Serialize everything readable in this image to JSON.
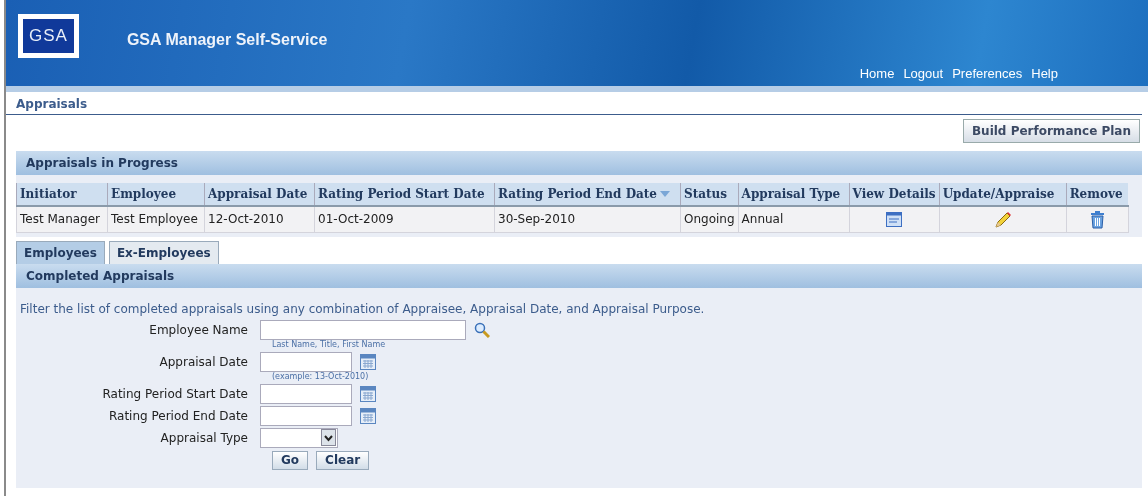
{
  "header": {
    "logo": "GSA",
    "title": "GSA Manager Self-Service",
    "links": [
      "Home",
      "Logout",
      "Preferences",
      "Help"
    ]
  },
  "page_title": "Appraisals",
  "actions": [
    "Build Performance Plan"
  ],
  "in_progress": {
    "title": "Appraisals in Progress",
    "columns": [
      {
        "label": "Initiator",
        "sorted": false
      },
      {
        "label": "Employee",
        "sorted": false
      },
      {
        "label": "Appraisal Date",
        "sorted": false
      },
      {
        "label": "Rating Period Start Date",
        "sorted": false
      },
      {
        "label": "Rating Period End Date",
        "sorted": true
      },
      {
        "label": "Status",
        "sorted": false
      },
      {
        "label": "Appraisal Type",
        "sorted": false
      },
      {
        "label": "View Details",
        "sorted": false
      },
      {
        "label": "Update/Appraise",
        "sorted": false
      },
      {
        "label": "Remove",
        "sorted": false
      }
    ],
    "rows": [
      {
        "cells": [
          "Test Manager",
          "Test Employee",
          "12-Oct-2010",
          "01-Oct-2009",
          "30-Sep-2010",
          "Ongoing",
          "Annual"
        ]
      }
    ]
  },
  "tabs": [
    {
      "label": "Employees",
      "selected": true
    },
    {
      "label": "Ex-Employees",
      "selected": false
    }
  ],
  "completed": {
    "title": "Completed Appraisals",
    "instructions": "Filter the list of completed appraisals using any combination of Appraisee, Appraisal Date, and Appraisal Purpose.",
    "fields": [
      {
        "kind": "lookup",
        "label": "Employee Name",
        "hint": "Last Name, Title, First Name"
      },
      {
        "kind": "date",
        "label": "Appraisal Date",
        "hint": "(example: 13-Oct-2010)"
      },
      {
        "kind": "date",
        "label": "Rating Period Start Date"
      },
      {
        "kind": "date",
        "label": "Rating Period End Date"
      },
      {
        "kind": "select",
        "label": "Appraisal Type"
      }
    ],
    "buttons": [
      "Go",
      "Clear"
    ]
  }
}
